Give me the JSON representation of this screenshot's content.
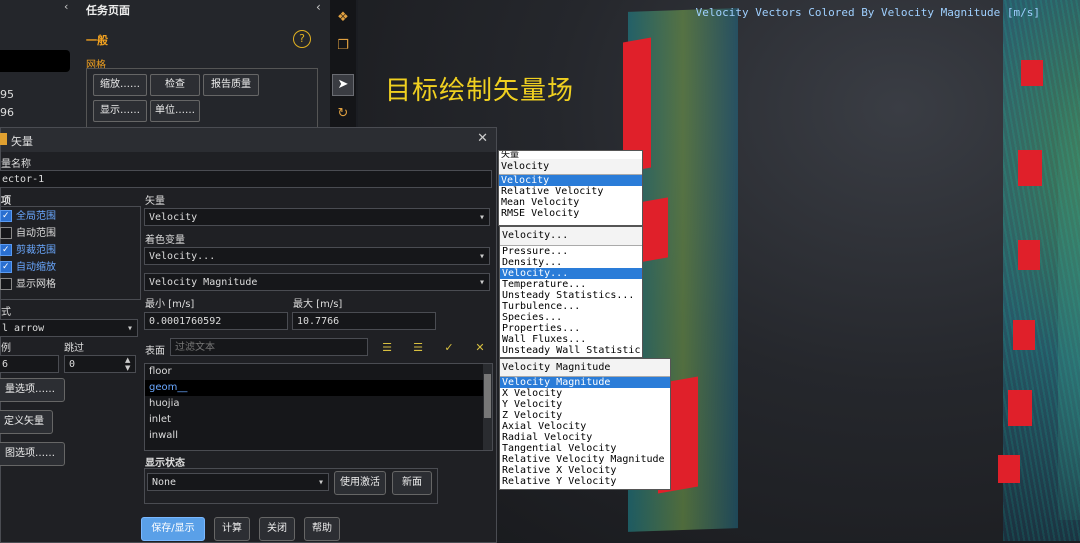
{
  "viewport": {
    "title": "Velocity Vectors Colored By Velocity Magnitude [m/s]",
    "annotation": "目标绘制矢量场"
  },
  "task_page": {
    "title": "任务页面",
    "general": "一般",
    "mesh_label": "网格",
    "buttons": [
      "缩放……",
      "检查",
      "报告质量",
      "显示……",
      "单位……"
    ],
    "left_values": [
      "95",
      "96"
    ]
  },
  "dialog": {
    "title": "矢量",
    "name_label": "量名称",
    "name_value": "ector-1",
    "options_label": "项",
    "options": [
      {
        "label": "全局范围",
        "checked": true
      },
      {
        "label": "自动范围",
        "checked": false
      },
      {
        "label": "剪裁范围",
        "checked": true
      },
      {
        "label": "自动缩放",
        "checked": true
      },
      {
        "label": "显示网格",
        "checked": false
      }
    ],
    "style_label": "式",
    "style_value": "l arrow",
    "scale_label": "例",
    "scale_value": "6",
    "skip_label": "跳过",
    "skip_value": "0",
    "btn_vector_options": "量选项……",
    "btn_custom_vectors": "定义矢量",
    "btn_colormap_options": "图选项……",
    "vectors_of_label": "矢量",
    "vectors_of_value": "Velocity",
    "color_by_label": "着色变量",
    "color_by_value": "Velocity...",
    "color_by_sub_value": "Velocity Magnitude",
    "min_label": "最小 [m/s]",
    "min_value": "0.0001760592",
    "max_label": "最大 [m/s]",
    "max_value": "10.7766",
    "surfaces_label": "表面",
    "filter_placeholder": "过滤文本",
    "surfaces": [
      "floor",
      "geom__",
      "huojia",
      "inlet",
      "inwall"
    ],
    "selected_surface": "geom__",
    "display_state_label": "显示状态",
    "display_state_value": "None",
    "btn_use_active": "使用激活",
    "btn_new": "新面",
    "btn_save_display": "保存/显示",
    "btn_compute": "计算",
    "btn_close": "关闭",
    "btn_help": "帮助"
  },
  "popups": {
    "vectors_of": {
      "head_top": "矢量",
      "head": "Velocity",
      "items": [
        "Velocity",
        "Relative Velocity",
        "Mean Velocity",
        "RMSE Velocity"
      ],
      "highlight": "Velocity"
    },
    "color_by": {
      "head": "Velocity...",
      "items": [
        "Pressure...",
        "Density...",
        "Velocity...",
        "Temperature...",
        "Unsteady Statistics...",
        "Turbulence...",
        "Species...",
        "Properties...",
        "Wall Fluxes...",
        "Unsteady Wall Statistic"
      ],
      "highlight": "Velocity..."
    },
    "color_sub": {
      "head": "Velocity Magnitude",
      "items": [
        "Velocity Magnitude",
        "X Velocity",
        "Y Velocity",
        "Z Velocity",
        "Axial Velocity",
        "Radial Velocity",
        "Tangential Velocity",
        "Relative Velocity Magnitude",
        "Relative X Velocity",
        "Relative Y Velocity"
      ],
      "highlight": "Velocity Magnitude"
    }
  }
}
